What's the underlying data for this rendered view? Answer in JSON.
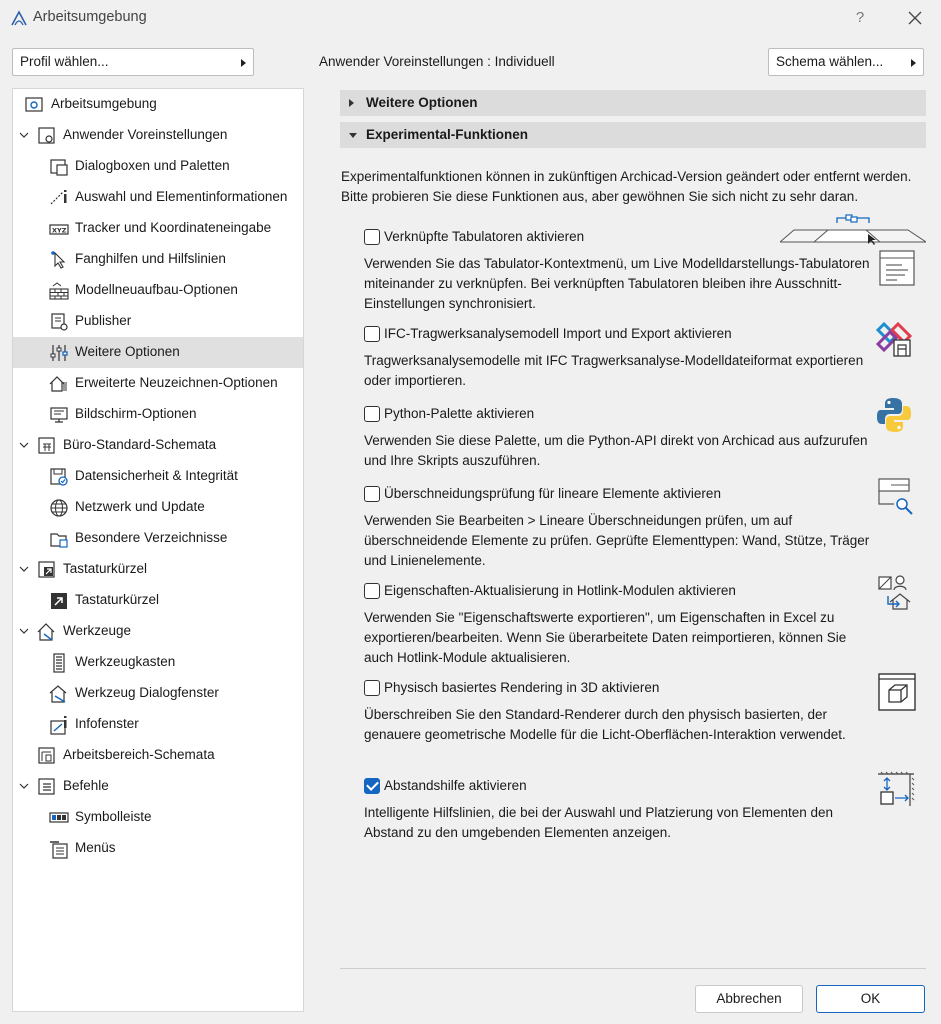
{
  "window": {
    "title": "Arbeitsumgebung",
    "help_label": "?"
  },
  "toolbar": {
    "profile_label": "Profil wählen...",
    "user_pref_label": "Anwender Voreinstellungen :",
    "user_pref_value": "Individuell",
    "schema_label": "Schema wählen..."
  },
  "tree": {
    "items": [
      {
        "label": "Arbeitsumgebung"
      },
      {
        "label": "Anwender Voreinstellungen"
      },
      {
        "label": "Dialogboxen und Paletten"
      },
      {
        "label": "Auswahl und Elementinformationen"
      },
      {
        "label": "Tracker und Koordinateneingabe"
      },
      {
        "label": "Fanghilfen und Hilfslinien"
      },
      {
        "label": "Modellneuaufbau-Optionen"
      },
      {
        "label": "Publisher"
      },
      {
        "label": "Weitere Optionen"
      },
      {
        "label": "Erweiterte Neuzeichnen-Optionen"
      },
      {
        "label": "Bildschirm-Optionen"
      },
      {
        "label": "Büro-Standard-Schemata"
      },
      {
        "label": "Datensicherheit & Integrität"
      },
      {
        "label": "Netzwerk und Update"
      },
      {
        "label": "Besondere Verzeichnisse"
      },
      {
        "label": "Tastaturkürzel"
      },
      {
        "label": "Tastaturkürzel"
      },
      {
        "label": "Werkzeuge"
      },
      {
        "label": "Werkzeugkasten"
      },
      {
        "label": "Werkzeug Dialogfenster"
      },
      {
        "label": "Infofenster"
      },
      {
        "label": "Arbeitsbereich-Schemata"
      },
      {
        "label": "Befehle"
      },
      {
        "label": "Symbolleiste"
      },
      {
        "label": "Menüs"
      }
    ]
  },
  "main": {
    "section_more": "Weitere Optionen",
    "section_experimental": "Experimental-Funktionen",
    "intro": "Experimentalfunktionen können in zukünftigen Archicad-Version geändert oder entfernt werden. Bitte probieren Sie diese Funktionen aus, aber gewöhnen Sie sich nicht zu sehr daran.",
    "options": [
      {
        "label": "Verknüpfte Tabulatoren aktivieren",
        "checked": false,
        "desc": "Verwenden Sie das Tabulator-Kontextmenü, um Live Modelldarstellungs-Tabulatoren miteinander zu verknüpfen. Bei verknüpften Tabulatoren bleiben ihre Ausschnitt-Einstellungen synchronisiert."
      },
      {
        "label": "IFC-Tragwerksanalysemodell Import und Export aktivieren",
        "checked": false,
        "desc": "Tragwerksanalysemodelle mit IFC Tragwerksanalyse-Modelldateiformat exportieren oder importieren."
      },
      {
        "label": "Python-Palette aktivieren",
        "checked": false,
        "desc": "Verwenden Sie diese Palette, um die Python-API direkt von Archicad aus aufzurufen und Ihre Skripts auszuführen."
      },
      {
        "label": "Überschneidungsprüfung für lineare Elemente aktivieren",
        "checked": false,
        "desc": "Verwenden Sie Bearbeiten > Lineare Überschneidungen prüfen, um auf überschneidende Elemente zu prüfen. Geprüfte Elementtypen: Wand, Stütze, Träger und Linienelemente."
      },
      {
        "label": "Eigenschaften-Aktualisierung in Hotlink-Modulen aktivieren",
        "checked": false,
        "desc": "Verwenden Sie \"Eigenschaftswerte exportieren\", um Eigenschaften in Excel zu exportieren/bearbeiten. Wenn Sie überarbeitete Daten reimportieren, können Sie auch Hotlink-Module aktualisieren."
      },
      {
        "label": "Physisch basiertes Rendering in 3D aktivieren",
        "checked": false,
        "desc": "Überschreiben Sie den Standard-Renderer durch den physisch basierten, der genauere geometrische Modelle für die Licht-Oberflächen-Interaktion verwendet."
      },
      {
        "label": "Abstandshilfe aktivieren",
        "checked": true,
        "desc": "Intelligente Hilfslinien, die bei der Auswahl und Platzierung von Elementen den Abstand zu den umgebenden Elementen anzeigen."
      }
    ]
  },
  "buttons": {
    "cancel": "Abbrechen",
    "ok": "OK"
  },
  "colors": {
    "accent": "#1566c0",
    "selected_row": "#e0e0e0",
    "section_header": "#dcdcdc"
  }
}
